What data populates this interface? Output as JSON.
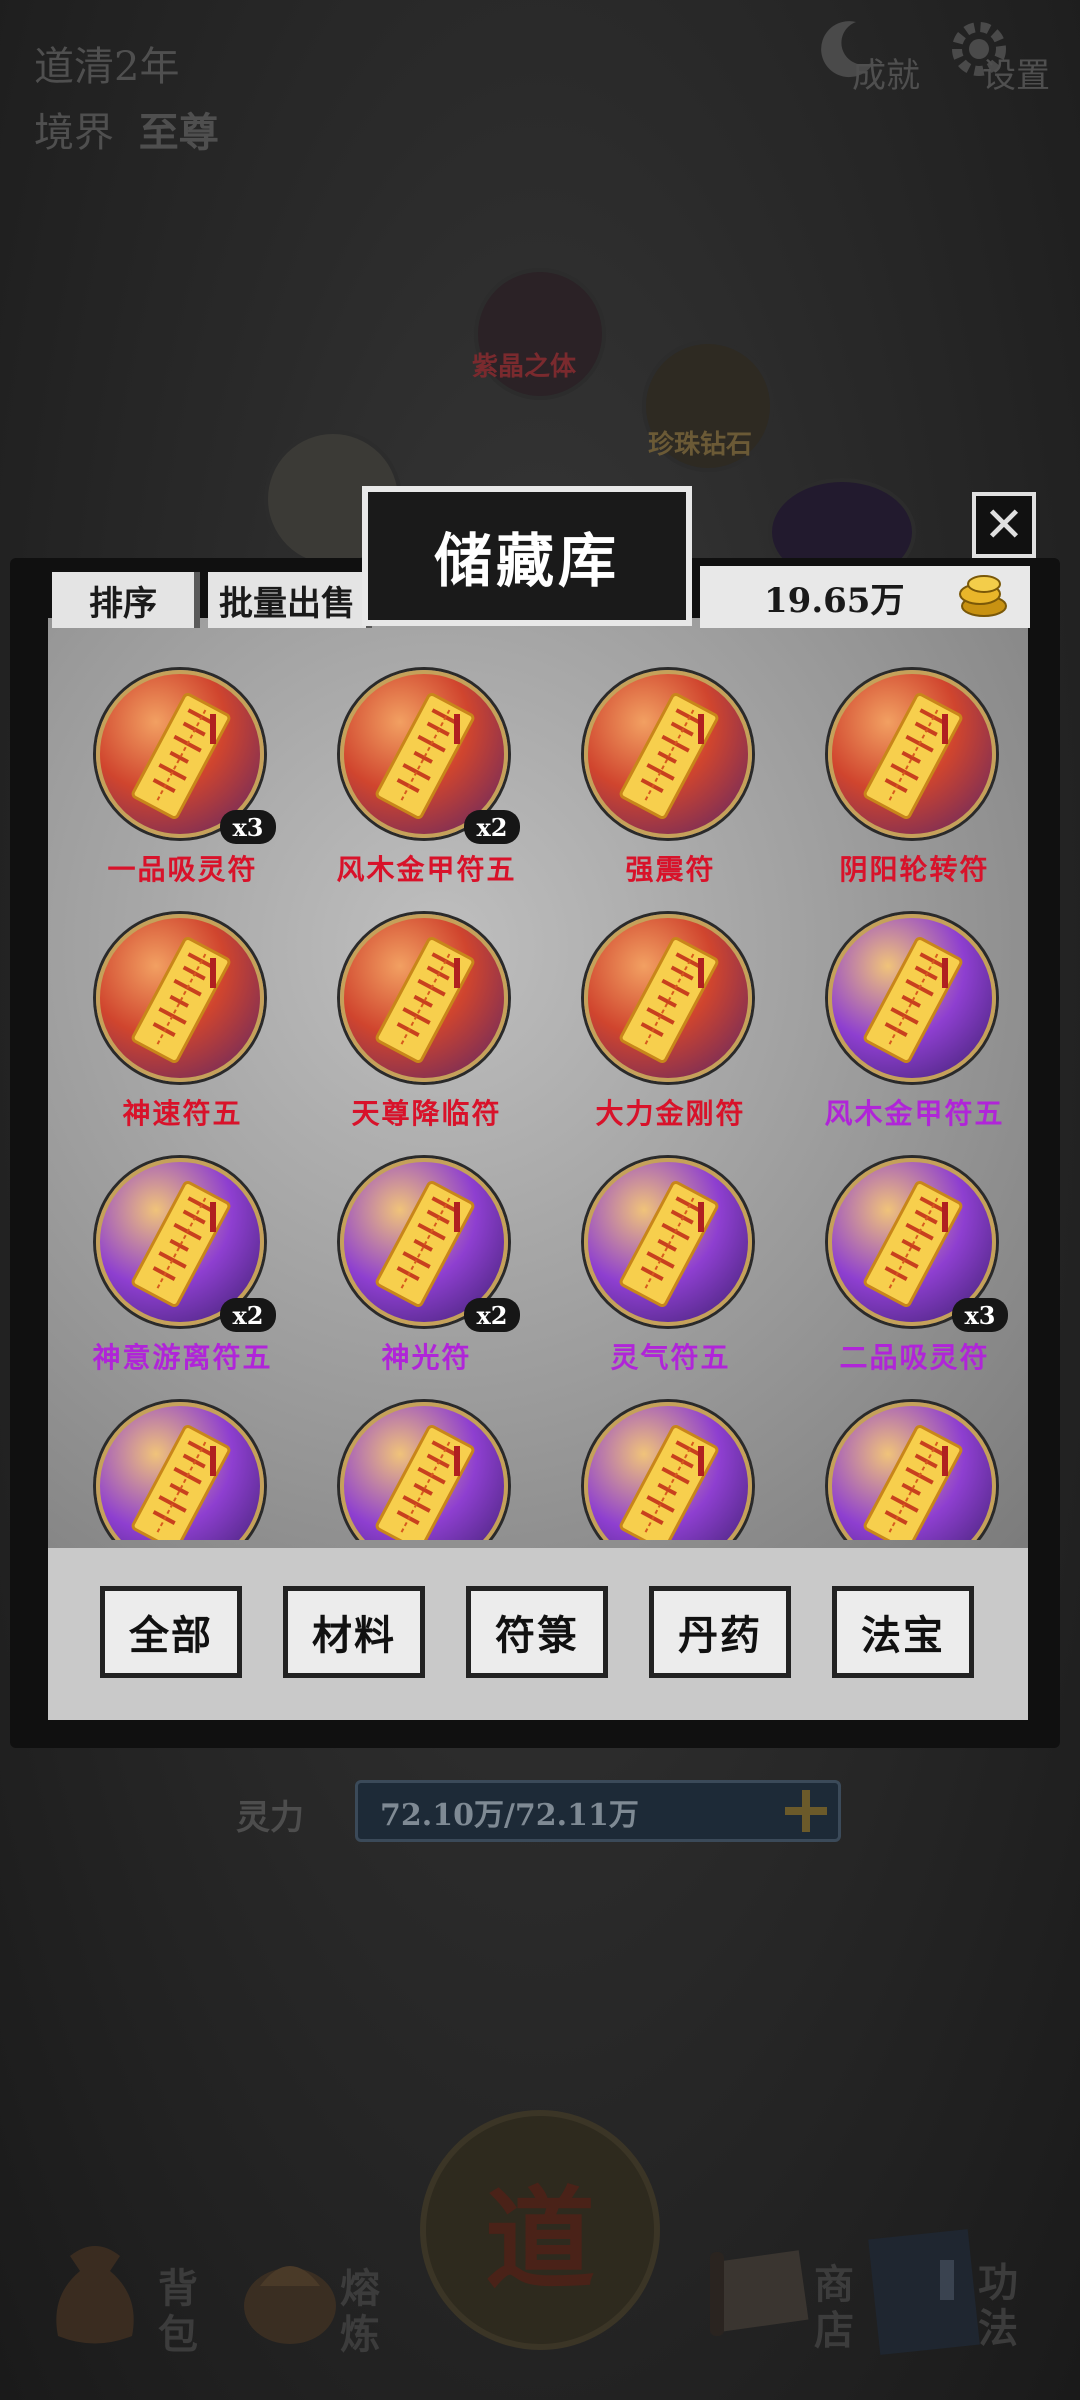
{
  "header": {
    "era": "道清2年",
    "realm_label": "境界",
    "realm_value": "至尊",
    "achievements": "成就",
    "settings": "设置"
  },
  "scene_orbs": [
    {
      "label": "紫晶之体",
      "color": "#a5323a"
    },
    {
      "label": "珍珠钻石",
      "color": "#c98a1a"
    }
  ],
  "storage": {
    "title": "储藏库",
    "close_icon": "close-icon",
    "sort_label": "排序",
    "batch_sell_label": "批量出售",
    "coins": "19.65万",
    "coin_icon": "gold-coins-icon",
    "items": [
      {
        "name": "一品吸灵符",
        "count": "x3",
        "tier": "red"
      },
      {
        "name": "风木金甲符五",
        "count": "x2",
        "tier": "red"
      },
      {
        "name": "强震符",
        "count": "",
        "tier": "red"
      },
      {
        "name": "阴阳轮转符",
        "count": "",
        "tier": "red"
      },
      {
        "name": "神速符五",
        "count": "",
        "tier": "red"
      },
      {
        "name": "天尊降临符",
        "count": "",
        "tier": "red"
      },
      {
        "name": "大力金刚符",
        "count": "",
        "tier": "red"
      },
      {
        "name": "风木金甲符五",
        "count": "",
        "tier": "purple"
      },
      {
        "name": "神意游离符五",
        "count": "x2",
        "tier": "purple"
      },
      {
        "name": "神光符",
        "count": "x2",
        "tier": "purple"
      },
      {
        "name": "灵气符五",
        "count": "",
        "tier": "purple"
      },
      {
        "name": "二品吸灵符",
        "count": "x3",
        "tier": "purple"
      },
      {
        "name": "",
        "count": "",
        "tier": "purple"
      },
      {
        "name": "",
        "count": "",
        "tier": "purple"
      },
      {
        "name": "",
        "count": "",
        "tier": "purple"
      },
      {
        "name": "",
        "count": "",
        "tier": "purple"
      }
    ],
    "tabs": [
      "全部",
      "材料",
      "符箓",
      "丹药",
      "法宝"
    ]
  },
  "status": {
    "spirit_label": "灵力",
    "spirit_value": "72.10万/72.11万"
  },
  "center_button": "道",
  "bottom_nav": [
    {
      "label": "背包",
      "icon": "bag-icon"
    },
    {
      "label": "熔炼",
      "icon": "furnace-icon"
    },
    {
      "label": "商店",
      "icon": "scroll-icon"
    },
    {
      "label": "功法",
      "icon": "book-icon"
    }
  ],
  "colors": {
    "tier_red": "#d8122a",
    "tier_purple": "#b025d8",
    "gold": "#c5a15a"
  }
}
